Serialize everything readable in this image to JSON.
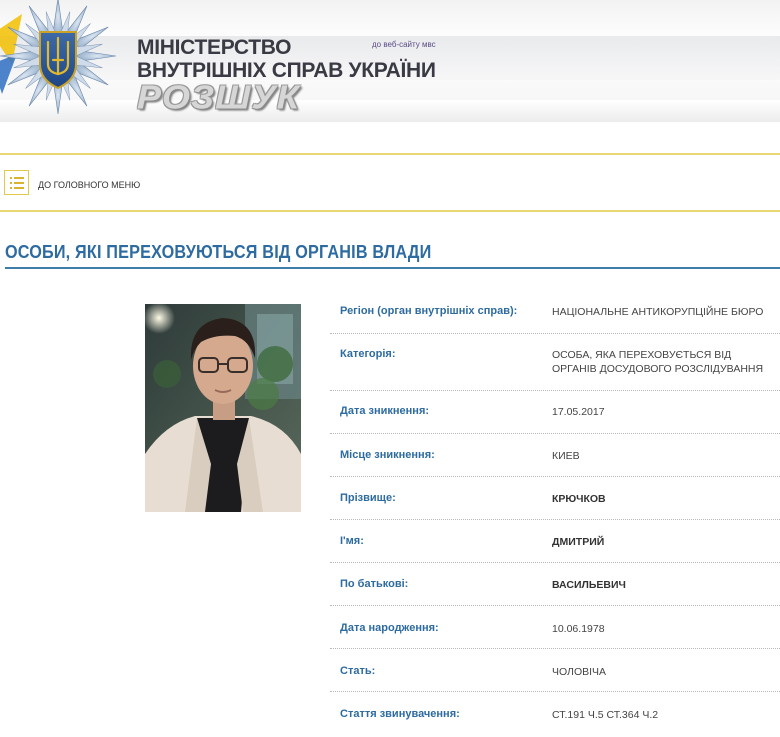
{
  "header": {
    "ministry_line1": "МІНІСТЕРСТВО",
    "ministry_line2": "ВНУТРІШНІХ СПРАВ УКРАЇНИ",
    "section_logo": "РОЗШУК",
    "site_link": "до веб-сайту мвс",
    "emblem_icon": "police-star-trident-icon"
  },
  "nav": {
    "menu_icon": "list-icon",
    "main_menu_label": "ДО ГОЛОВНОГО МЕНЮ"
  },
  "page": {
    "title": "ОСОБИ, ЯКІ ПЕРЕХОВУЮТЬСЯ ВІД ОРГАНІВ ВЛАДИ"
  },
  "person": {
    "fields": [
      {
        "label": "Регіон (орган внутрішніх справ):",
        "value": "НАЦІОНАЛЬНЕ АНТИКОРУПЦІЙНЕ БЮРО"
      },
      {
        "label": "Категорія:",
        "value": "ОСОБА, ЯКА ПЕРЕХОВУЄТЬСЯ ВІД ОРГАНІВ ДОСУДОВОГО РОЗСЛІДУВАННЯ"
      },
      {
        "label": "Дата зникнення:",
        "value": "17.05.2017"
      },
      {
        "label": "Місце зникнення:",
        "value": "КИЕВ"
      },
      {
        "label": "Прізвище:",
        "value": "КРЮЧКОВ"
      },
      {
        "label": "І'мя:",
        "value": "ДМИТРИЙ"
      },
      {
        "label": "По батькові:",
        "value": "ВАСИЛЬЕВИЧ"
      },
      {
        "label": "Дата народження:",
        "value": "10.06.1978"
      },
      {
        "label": "Стать:",
        "value": "ЧОЛОВІЧА"
      },
      {
        "label": "Стаття звинувачення:",
        "value": "СТ.191 Ч.5 СТ.364 Ч.2"
      }
    ]
  },
  "colors": {
    "accent_blue": "#2d6ba0",
    "divider_yellow": "#e8d874",
    "title_underline": "#3e7ca9"
  }
}
